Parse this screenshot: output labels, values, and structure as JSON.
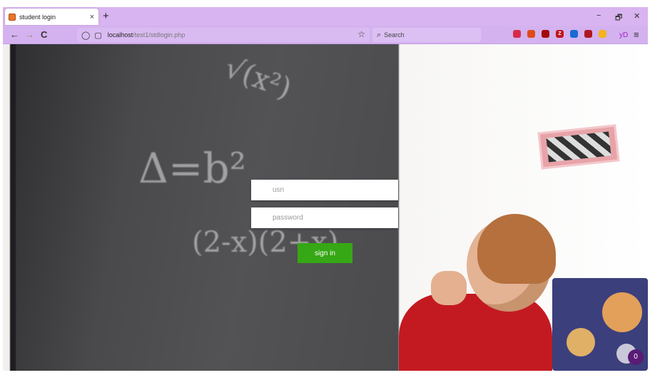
{
  "browser": {
    "tab": {
      "title": "student login",
      "close_icon": "×"
    },
    "new_tab_icon": "+",
    "window_controls": {
      "minimize": "−",
      "restore": "🗗",
      "close": "✕"
    },
    "nav": {
      "back": "←",
      "forward": "→",
      "reload": "C"
    },
    "url": {
      "host": "localhost",
      "path": "/test1/stdlogin.php"
    },
    "search_placeholder": "Search",
    "extensions": [
      {
        "name": "pocket-icon",
        "color": "#d62b4a",
        "glyph": ""
      },
      {
        "name": "privacy-badger-icon",
        "color": "#e04a1a",
        "glyph": ""
      },
      {
        "name": "ublock-icon",
        "color": "#a20b0b",
        "glyph": ""
      },
      {
        "name": "zotero-icon",
        "color": "#c3151c",
        "glyph": "Z"
      },
      {
        "name": "bitwarden-icon",
        "color": "#1b6ad1",
        "glyph": ""
      },
      {
        "name": "shield-icon",
        "color": "#b01822",
        "glyph": ""
      },
      {
        "name": "vpn-icon",
        "color": "#f3b31e",
        "glyph": ""
      }
    ],
    "profile_text": "yD",
    "menu_icon": "≡"
  },
  "login": {
    "usn_placeholder": "usn",
    "password_placeholder": "password",
    "signin_label": "sign in"
  },
  "badge_count": "0"
}
